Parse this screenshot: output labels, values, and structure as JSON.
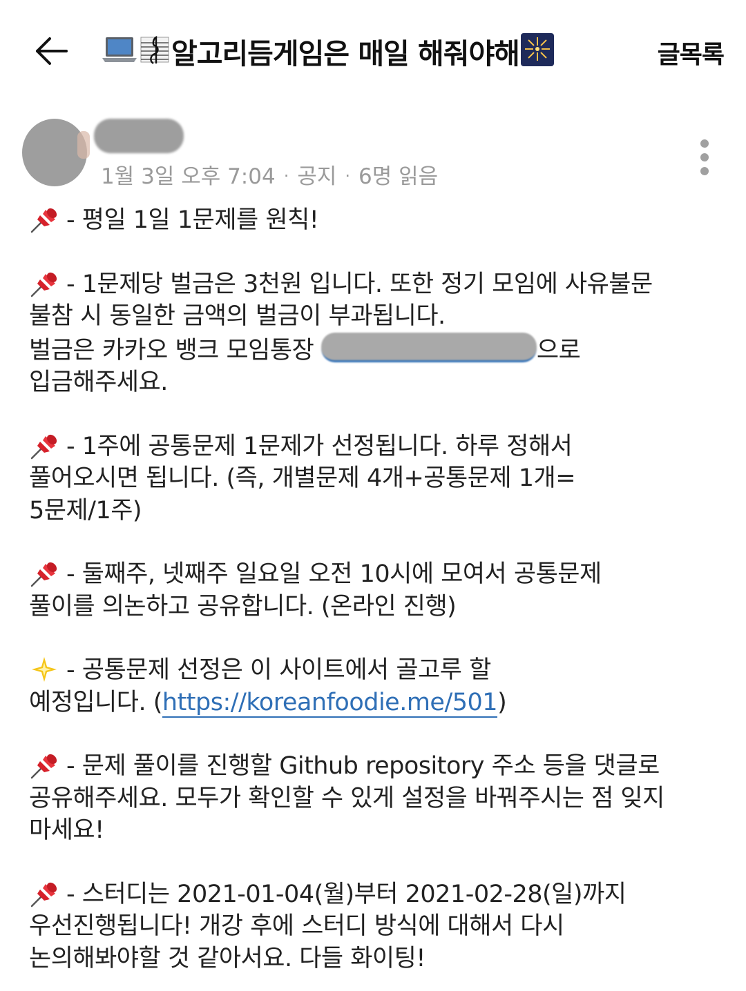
{
  "header": {
    "title": "알고리듬게임은 매일 해줘야해",
    "list_label": "글목록"
  },
  "post": {
    "date": "1월 3일 오후 7:04",
    "type": "공지",
    "views": "6명 읽음"
  },
  "paragraphs": [
    {
      "icon": "pushpin-icon",
      "lines": [
        "- 평일 1일 1문제를 원칙!"
      ]
    },
    {
      "icon": "pushpin-icon",
      "lines": [
        "- 1문제당 벌금은 3천원 입니다. 또한 정기 모임에 사유불문",
        "불참 시 동일한 금액의 벌금이 부과됩니다.",
        "벌금은 카카오 뱅크 모임통장",
        "으로",
        "입금해주세요."
      ]
    },
    {
      "icon": "pushpin-icon",
      "lines": [
        "- 1주에 공통문제 1문제가 선정됩니다. 하루 정해서",
        "풀어오시면 됩니다. (즉, 개별문제 4개+공통문제 1개=",
        "5문제/1주)"
      ]
    },
    {
      "icon": "pushpin-icon",
      "lines": [
        "- 둘째주, 넷째주 일요일 오전 10시에 모여서 공통문제",
        "풀이를 의논하고 공유합니다. (온라인 진행)"
      ]
    },
    {
      "icon": "sparkle-star-icon",
      "lines": [
        "- 공통문제 선정은 이 사이트에서 골고루 할",
        "예정입니다. (",
        "https://koreanfoodie.me/501",
        ")"
      ]
    },
    {
      "icon": "pushpin-icon",
      "lines": [
        "- 문제 풀이를 진행할 Github repository 주소 등을 댓글로",
        "공유해주세요. 모두가 확인할 수 있게 설정을 바꿔주시는 점 잊지",
        "마세요!"
      ]
    },
    {
      "icon": "pushpin-icon",
      "lines": [
        "- 스터디는 2021-01-04(월)부터 2021-02-28(일)까지",
        "우선진행됩니다! 개강 후에 스터디 방식에 대해서 다시",
        "논의해봐야할 것 같아서요. 다들 화이팅!"
      ]
    }
  ],
  "colors": {
    "link": "#2f6fb6",
    "meta": "#9a9a9a",
    "text": "#222222"
  }
}
